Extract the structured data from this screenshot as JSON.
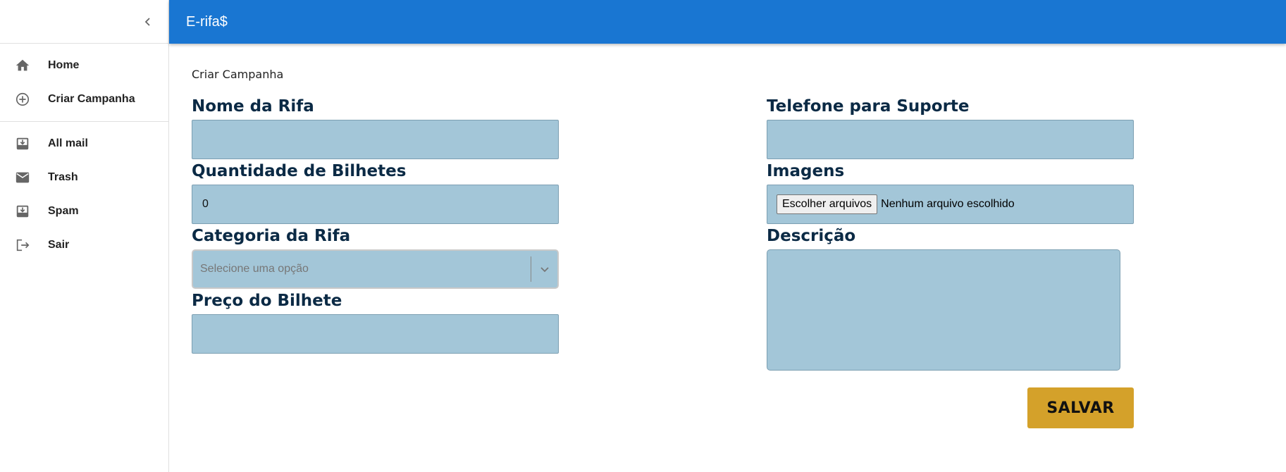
{
  "app": {
    "title": "E-rifa$"
  },
  "sidebar": {
    "collapse_icon": "chevron-left-icon",
    "groups": [
      [
        {
          "label": "Home",
          "icon": "home-icon"
        },
        {
          "label": "Criar Campanha",
          "icon": "add-circle-outline-icon"
        }
      ],
      [
        {
          "label": "All mail",
          "icon": "inbox-download-icon"
        },
        {
          "label": "Trash",
          "icon": "mail-icon"
        },
        {
          "label": "Spam",
          "icon": "inbox-download-icon"
        },
        {
          "label": "Sair",
          "icon": "logout-icon"
        }
      ]
    ]
  },
  "page": {
    "title": "Criar Campanha"
  },
  "form": {
    "nome": {
      "label": "Nome da Rifa",
      "value": ""
    },
    "quantidade": {
      "label": "Quantidade de Bilhetes",
      "value": "0"
    },
    "categoria": {
      "label": "Categoria da Rifa",
      "placeholder": "Selecione uma opção"
    },
    "preco": {
      "label": "Preço do Bilhete",
      "value": ""
    },
    "telefone": {
      "label": "Telefone para Suporte",
      "value": ""
    },
    "imagens": {
      "label": "Imagens",
      "button_label": "Escolher arquivos",
      "status": "Nenhum arquivo escolhido"
    },
    "descricao": {
      "label": "Descrição",
      "value": ""
    },
    "save_label": "SALVAR"
  },
  "colors": {
    "appbar": "#1976d2",
    "input_bg": "#a3c6d8",
    "label": "#0b2a45",
    "save_button": "#d4a12a"
  }
}
